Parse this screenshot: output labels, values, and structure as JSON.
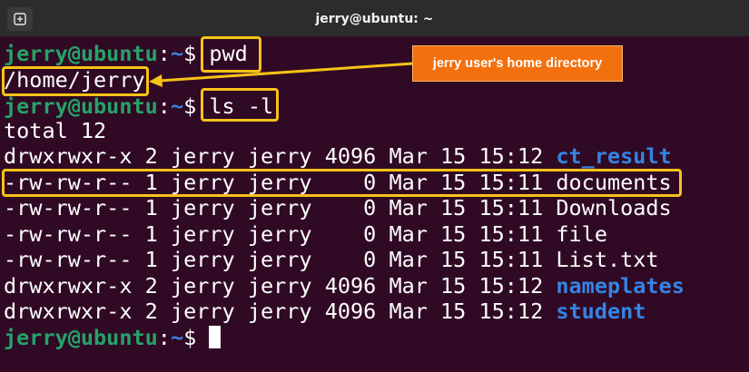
{
  "window": {
    "title": "jerry@ubuntu: ~",
    "new_tab_icon": "new-tab-icon"
  },
  "prompt": {
    "user_host": "jerry@ubuntu",
    "colon": ":",
    "path": "~",
    "dollar": "$ "
  },
  "commands": {
    "pwd": "pwd",
    "ls": "ls -l"
  },
  "output": {
    "pwd_result": "/home/jerry",
    "total": "total 12",
    "rows": [
      {
        "meta": "drwxrwxr-x 2 jerry jerry 4096 Mar 15 15:12 ",
        "name": "ct_result",
        "is_dir": true
      },
      {
        "meta": "-rw-rw-r-- 1 jerry jerry    0 Mar 15 15:11 ",
        "name": "documents",
        "is_dir": false
      },
      {
        "meta": "-rw-rw-r-- 1 jerry jerry    0 Mar 15 15:11 ",
        "name": "Downloads",
        "is_dir": false
      },
      {
        "meta": "-rw-rw-r-- 1 jerry jerry    0 Mar 15 15:11 ",
        "name": "file",
        "is_dir": false
      },
      {
        "meta": "-rw-rw-r-- 1 jerry jerry    0 Mar 15 15:11 ",
        "name": "List.txt",
        "is_dir": false
      },
      {
        "meta": "drwxrwxr-x 2 jerry jerry 4096 Mar 15 15:12 ",
        "name": "nameplates",
        "is_dir": true
      },
      {
        "meta": "drwxrwxr-x 2 jerry jerry 4096 Mar 15 15:12 ",
        "name": "student",
        "is_dir": true
      }
    ]
  },
  "annotation": {
    "callout_text": "jerry user's home directory"
  },
  "colors": {
    "background": "#300a24",
    "prompt_user": "#26a269",
    "prompt_path": "#3b82e6",
    "directory": "#3584e4",
    "highlight": "#f7c217",
    "callout": "#f3700f"
  }
}
